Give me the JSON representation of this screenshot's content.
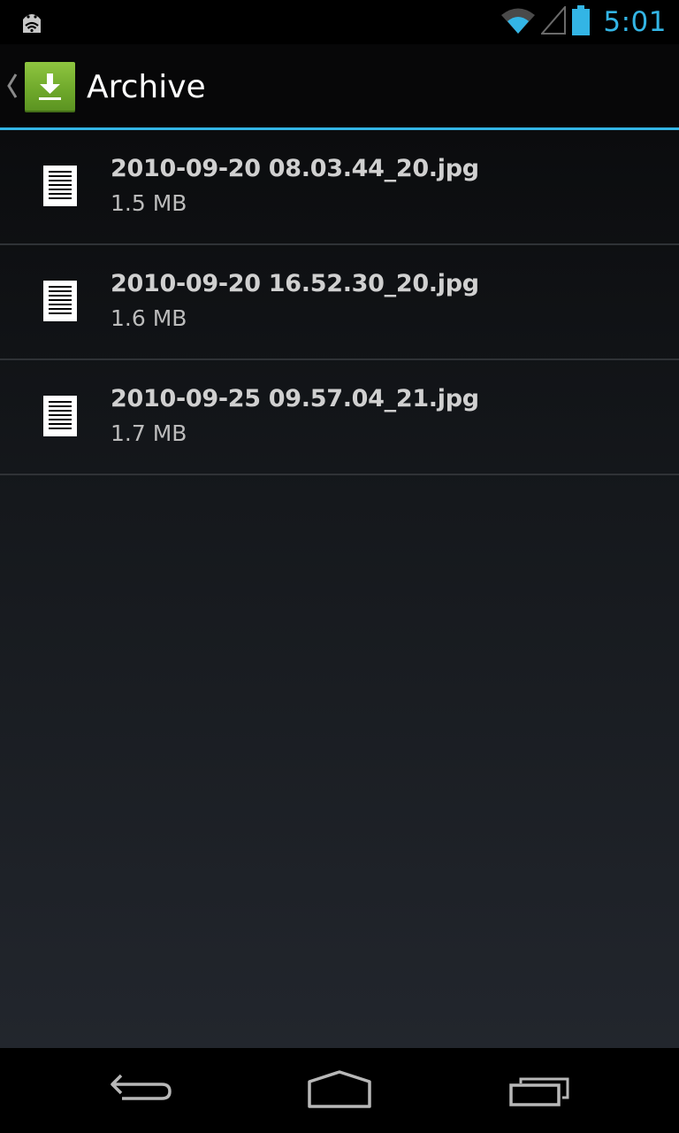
{
  "status_bar": {
    "time": "5:01",
    "left_icon": "android-notification-icon",
    "icons": [
      "wifi-icon",
      "signal-icon",
      "battery-icon"
    ],
    "accent_color": "#33b5e5"
  },
  "action_bar": {
    "title": "Archive",
    "app_icon": "download-icon",
    "up_icon": "up-caret-icon",
    "accent_color": "#33b5e5",
    "icon_color": "#7db635"
  },
  "files": [
    {
      "name": "2010-09-20 08.03.44_20.jpg",
      "size": "1.5 MB",
      "icon": "document-icon"
    },
    {
      "name": "2010-09-20 16.52.30_20.jpg",
      "size": "1.6 MB",
      "icon": "document-icon"
    },
    {
      "name": "2010-09-25 09.57.04_21.jpg",
      "size": "1.7 MB",
      "icon": "document-icon"
    }
  ],
  "nav_bar": {
    "buttons": [
      "back-icon",
      "home-icon",
      "recent-apps-icon"
    ]
  }
}
